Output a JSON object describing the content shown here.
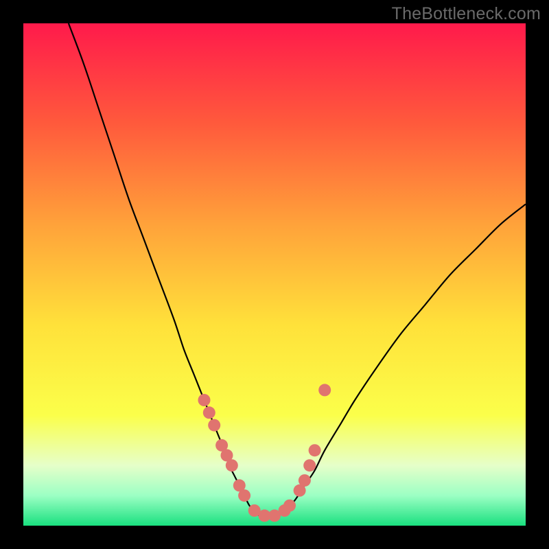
{
  "watermark": "TheBottleneck.com",
  "chart_data": {
    "type": "line",
    "title": "",
    "xlabel": "",
    "ylabel": "",
    "xlim": [
      0,
      100
    ],
    "ylim": [
      0,
      100
    ],
    "series": [
      {
        "name": "curve",
        "x": [
          9,
          12,
          15,
          18,
          21,
          24,
          27,
          30,
          32,
          34,
          36,
          38,
          40,
          41,
          42,
          43,
          44,
          45,
          46,
          47,
          48,
          49,
          50,
          52,
          54,
          56,
          58,
          60,
          63,
          66,
          70,
          75,
          80,
          85,
          90,
          95,
          100
        ],
        "y": [
          100,
          92,
          83,
          74,
          65,
          57,
          49,
          41,
          35,
          30,
          25,
          20,
          15,
          12,
          10,
          8,
          6,
          4,
          3,
          2,
          2,
          2,
          2,
          3,
          5,
          8,
          11,
          15,
          20,
          25,
          31,
          38,
          44,
          50,
          55,
          60,
          64
        ]
      }
    ],
    "markers": {
      "name": "highlighted-points",
      "color": "#e0746f",
      "x": [
        36,
        37,
        38,
        39.5,
        40.5,
        41.5,
        43,
        44,
        46,
        48,
        50,
        52,
        53,
        55,
        56,
        57,
        58,
        60
      ],
      "y": [
        25,
        22.5,
        20,
        16,
        14,
        12,
        8,
        6,
        3,
        2,
        2,
        3,
        4,
        7,
        9,
        12,
        15,
        27
      ]
    },
    "background_gradient": {
      "stops": [
        {
          "offset": 0.0,
          "color": "#ff1a4b"
        },
        {
          "offset": 0.2,
          "color": "#ff5a3c"
        },
        {
          "offset": 0.4,
          "color": "#ffa23a"
        },
        {
          "offset": 0.6,
          "color": "#ffe13a"
        },
        {
          "offset": 0.78,
          "color": "#fbff4a"
        },
        {
          "offset": 0.88,
          "color": "#e6ffc9"
        },
        {
          "offset": 0.94,
          "color": "#9cffc4"
        },
        {
          "offset": 1.0,
          "color": "#19e07f"
        }
      ]
    }
  }
}
